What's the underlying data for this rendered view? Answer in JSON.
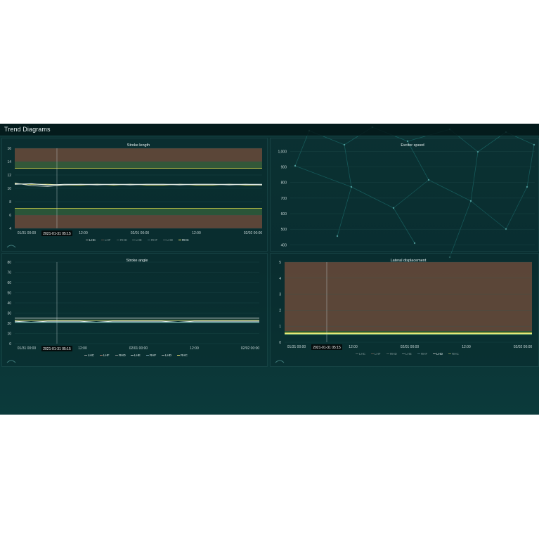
{
  "app": {
    "title": "Trend Diagrams"
  },
  "tooltip_time": "2021-01-31 05:15",
  "colors": {
    "alarm_band": "#6a4a3a",
    "warning_band": "#2f5a3a",
    "threshold_line": "#d8d64a",
    "grid": "#2a5a5a",
    "background": "#0a2f31"
  },
  "legend_series": [
    {
      "name": "LHC",
      "color": "#9aa0a0"
    },
    {
      "name": "LHF",
      "color": "#b07a6a"
    },
    {
      "name": "RHD",
      "color": "#8a9090"
    },
    {
      "name": "LHE",
      "color": "#b0c0c0"
    },
    {
      "name": "RHF",
      "color": "#7aa0b0"
    },
    {
      "name": "LHD",
      "color": "#a0a8a8"
    },
    {
      "name": "RHC",
      "color": "#e8e070"
    }
  ],
  "chart_data": [
    {
      "type": "line",
      "title": "Stroke length",
      "x_ticks": [
        "01/31 00:00",
        "12:00",
        "02/01 00:00",
        "12:00",
        "02/02 00:00"
      ],
      "y_ticks": [
        "4",
        "6",
        "8",
        "10",
        "12",
        "14",
        "16"
      ],
      "ylim": [
        4,
        16
      ],
      "bands": [
        {
          "from": 13,
          "to": 16,
          "kind": "alarm"
        },
        {
          "from": 13,
          "to": 14,
          "kind": "warning"
        },
        {
          "from": 6,
          "to": 7,
          "kind": "warning"
        },
        {
          "from": 4,
          "to": 6,
          "kind": "alarm"
        }
      ],
      "thresholds": [
        13,
        7
      ],
      "series": [
        {
          "name": "RHC",
          "values": [
            10.7,
            10.6,
            10.6,
            10.5,
            10.5,
            10.6,
            10.5,
            10.6,
            10.5,
            10.5,
            10.6,
            10.5,
            10.5,
            10.6,
            10.5,
            10.5
          ]
        },
        {
          "name": "LHC",
          "values": [
            10.8,
            10.4,
            10.3,
            10.5,
            10.6,
            10.5,
            10.6,
            10.5,
            10.6,
            10.6,
            10.5,
            10.6,
            10.6,
            10.5,
            10.6,
            10.5
          ]
        },
        {
          "name": "LHE",
          "values": [
            10.6,
            10.7,
            10.5,
            10.6,
            10.6,
            10.6,
            10.6,
            10.6,
            10.6,
            10.6,
            10.6,
            10.6,
            10.6,
            10.6,
            10.6,
            10.6
          ]
        }
      ],
      "legend": [
        "LHC",
        "LHF",
        "RHD",
        "LHE",
        "RHF",
        "LHD",
        "RHC"
      ],
      "legend_dim": [
        false,
        true,
        true,
        true,
        true,
        true,
        false
      ]
    },
    {
      "type": "line",
      "title": "Exciter speed",
      "x_ticks": [],
      "y_ticks": [
        "400",
        "500",
        "600",
        "700",
        "800",
        "900",
        "1,000"
      ],
      "ylim": [
        370,
        1020
      ],
      "bands": [],
      "thresholds": [],
      "series": [],
      "legend": [],
      "legend_dim": []
    },
    {
      "type": "line",
      "title": "Stroke angle",
      "x_ticks": [
        "01/31 00:00",
        "12:00",
        "02/01 00:00",
        "12:00",
        "02/02 00:00"
      ],
      "y_ticks": [
        "0",
        "10",
        "20",
        "30",
        "40",
        "50",
        "60",
        "70",
        "80"
      ],
      "ylim": [
        0,
        80
      ],
      "bands": [],
      "thresholds": [],
      "series": [
        {
          "name": "LHC",
          "values": [
            25,
            25,
            25,
            25,
            25,
            25,
            25,
            25,
            25,
            25,
            25,
            25,
            25,
            25,
            25,
            25
          ]
        },
        {
          "name": "RHC",
          "values": [
            23,
            23,
            23,
            23,
            23,
            23,
            23,
            23,
            23,
            23,
            23,
            23,
            23,
            23,
            23,
            23
          ]
        },
        {
          "name": "LHE",
          "values": [
            22,
            21,
            22,
            22,
            22,
            21,
            22,
            22,
            22,
            22,
            21,
            22,
            22,
            22,
            22,
            22
          ]
        },
        {
          "name": "RHF",
          "values": [
            21,
            21,
            21,
            21,
            21,
            21,
            21,
            21,
            21,
            21,
            21,
            21,
            21,
            21,
            21,
            21
          ]
        }
      ],
      "legend": [
        "LHC",
        "LHF",
        "RHD",
        "LHE",
        "RHF",
        "LHD",
        "RHC"
      ],
      "legend_dim": [
        false,
        false,
        false,
        false,
        false,
        false,
        false
      ]
    },
    {
      "type": "line",
      "title": "Lateral displacement",
      "x_ticks": [
        "01/31 00:00",
        "12:00",
        "02/01 00:00",
        "12:00",
        "02/02 00:00"
      ],
      "y_ticks": [
        "0",
        "1",
        "2",
        "3",
        "4",
        "5"
      ],
      "ylim": [
        0,
        5
      ],
      "bands": [
        {
          "from": 0.7,
          "to": 5,
          "kind": "alarm"
        },
        {
          "from": 0.6,
          "to": 0.7,
          "kind": "warning"
        }
      ],
      "thresholds": [
        0.6
      ],
      "series": [
        {
          "name": "RHC",
          "values": [
            0.55,
            0.55,
            0.55,
            0.55,
            0.55,
            0.55,
            0.55,
            0.55,
            0.55,
            0.55,
            0.55,
            0.55,
            0.55,
            0.55,
            0.55,
            0.55
          ]
        },
        {
          "name": "LHD",
          "values": [
            0.5,
            0.5,
            0.5,
            0.5,
            0.5,
            0.5,
            0.5,
            0.5,
            0.5,
            0.5,
            0.5,
            0.5,
            0.5,
            0.5,
            0.5,
            0.5
          ]
        }
      ],
      "legend": [
        "LHC",
        "LHF",
        "RHD",
        "LHE",
        "RHF",
        "LHD",
        "RHC"
      ],
      "legend_dim": [
        true,
        true,
        true,
        true,
        true,
        false,
        true
      ]
    }
  ]
}
